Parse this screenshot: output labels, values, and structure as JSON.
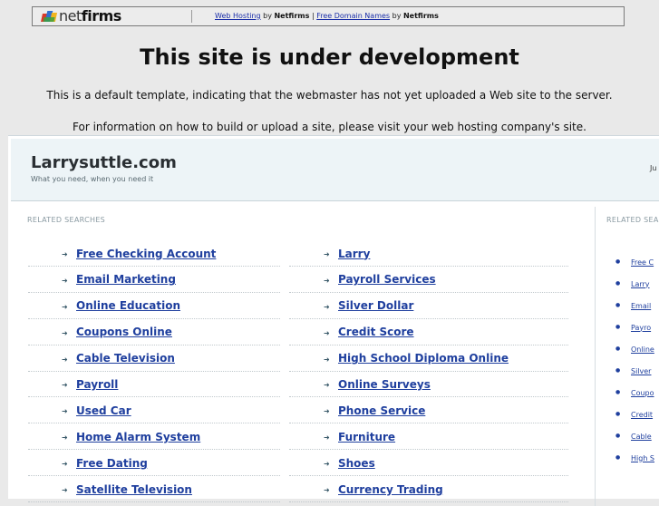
{
  "banner": {
    "logo_text_light": "net",
    "logo_text_bold": "firms",
    "links": [
      {
        "label": "Web Hosting"
      },
      {
        "label": "Free Domain Names"
      }
    ],
    "by1": "by",
    "brand1": "Netfirms",
    "sep": "|",
    "by2": "by",
    "brand2": "Netfirms"
  },
  "headline": "This site is under development",
  "notice1": "This is a default template, indicating that the webmaster has not yet uploaded a Web site to the server.",
  "notice2": "For information on how to build or upload a site, please visit your web hosting company's site.",
  "site": {
    "title": "Larrysuttle.com",
    "tagline": "What you need, when you need it",
    "date": "Ju",
    "related_label": "RELATED SEARCHES",
    "related_label_right": "RELATED SEA",
    "left_links": [
      "Free Checking Account",
      "Email Marketing",
      "Online Education",
      "Coupons Online",
      "Cable Television",
      "Payroll",
      "Used Car",
      "Home Alarm System",
      "Free Dating",
      "Satellite Television"
    ],
    "mid_links": [
      "Larry",
      "Payroll Services",
      "Silver Dollar",
      "Credit Score",
      "High School Diploma Online",
      "Online Surveys",
      "Phone Service",
      "Furniture",
      "Shoes",
      "Currency Trading"
    ],
    "side_links": [
      "Free C",
      "Larry",
      "Email",
      "Payro",
      "Online",
      "Silver",
      "Coupo",
      "Credit",
      "Cable",
      "High S"
    ]
  },
  "icons": {
    "logo": "netfirms-logo-icon",
    "arrow": "right-arrow-icon",
    "bullet": "bullet-icon"
  }
}
